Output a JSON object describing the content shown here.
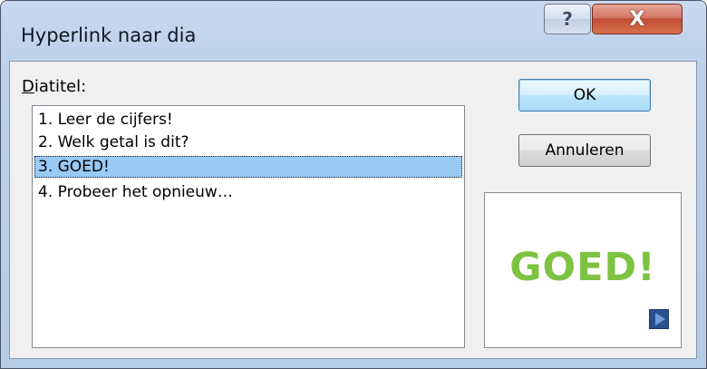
{
  "window": {
    "title": "Hyperlink naar dia",
    "help_glyph": "?",
    "close_glyph": "X"
  },
  "list": {
    "label_underlined": "D",
    "label_rest": "iatitel:",
    "items": [
      "1. Leer de cijfers!",
      "2. Welk getal is dit?",
      "3. GOED!",
      "4. Probeer het opnieuw…"
    ],
    "selected_index": 2
  },
  "buttons": {
    "ok_label": "OK",
    "cancel_label": "Annuleren"
  },
  "preview": {
    "slide_text": "GOED!",
    "slide_text_color": "#7ec242",
    "nav_icon": "play-arrow-icon"
  },
  "colors": {
    "selection": "#99c9f5",
    "close_button": "#c24e37",
    "frame": "#bcd0ea"
  }
}
